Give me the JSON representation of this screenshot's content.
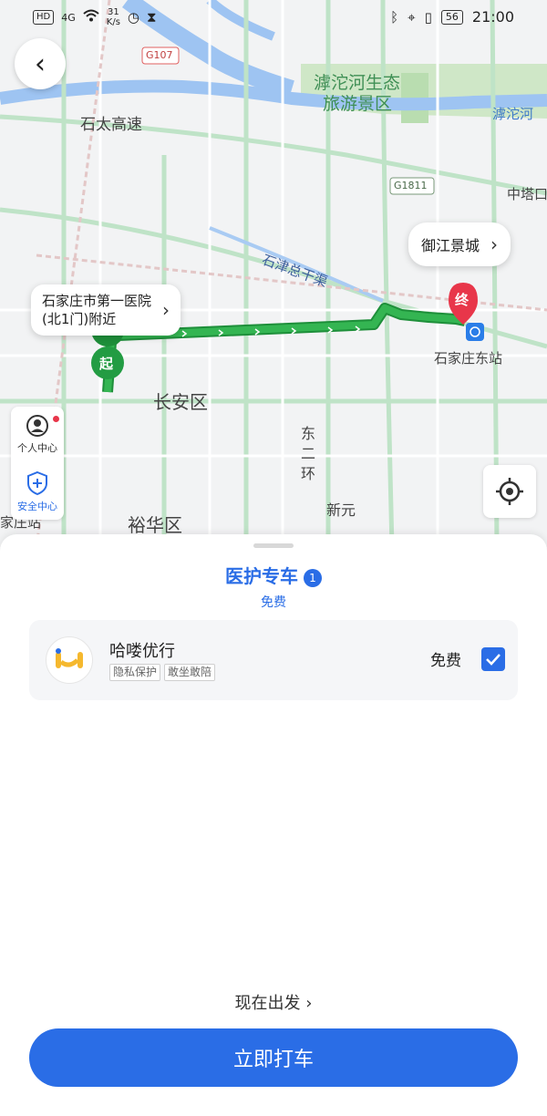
{
  "status_bar": {
    "hd_badge": "HD",
    "signal": "4G",
    "net_speed_value": "31",
    "net_speed_unit": "K/s",
    "battery": "56",
    "time": "21:00"
  },
  "map": {
    "labels": {
      "river_area": "滹沱河生态",
      "scenic_area": "旅游景区",
      "river": "滹沱河",
      "expressway": "石太高速",
      "highway_g107": "G107",
      "highway_g1811": "G1811",
      "zhongta": "中塔口",
      "canal": "石津总干渠",
      "district_changan": "长安区",
      "district_yuhua": "裕华区",
      "ring_road_1": "东",
      "ring_road_2": "二",
      "ring_road_3": "环",
      "xinyuan": "新元",
      "east_station": "石家庄东站",
      "jiazhuang": "家庄站"
    },
    "start_callout": {
      "line1": "石家庄市第一医院",
      "line2": "(北1门)附近"
    },
    "end_callout": "御江景城",
    "start_marker": "起",
    "end_marker": "终",
    "side_panel": {
      "personal": "个人中心",
      "safety": "安全中心"
    }
  },
  "sheet": {
    "service_title": "医护专车",
    "service_count": "1",
    "service_sub": "免费",
    "provider": {
      "name": "哈喽优行",
      "tags": [
        "隐私保护",
        "敢坐敢陪"
      ],
      "price": "免费",
      "selected": true
    },
    "depart_now": "现在出发",
    "call_button": "立即打车"
  },
  "colors": {
    "accent": "#2a6de6",
    "route": "#27a844",
    "end_marker": "#e8364a"
  },
  "icons": [
    "back-icon",
    "bluetooth-icon",
    "location-icon",
    "vibrate-icon",
    "person-icon",
    "shield-icon",
    "locate-icon",
    "checkmark-icon",
    "chevron-right-icon",
    "station-icon"
  ]
}
